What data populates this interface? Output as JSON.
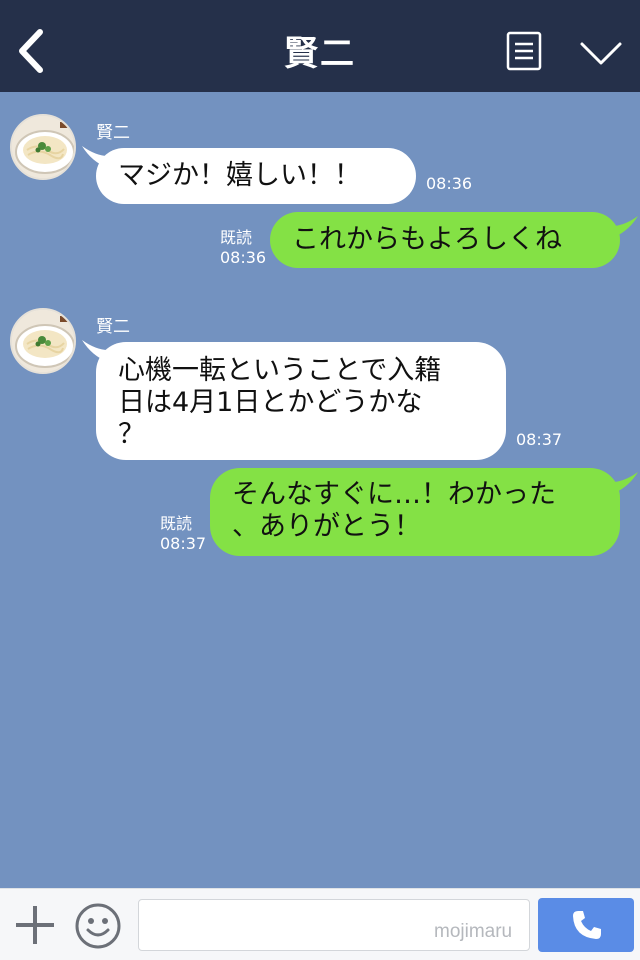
{
  "header": {
    "title": "賢二"
  },
  "icons": {
    "back": "chevron-left-icon",
    "menu": "document-menu-icon",
    "collapse": "chevron-down-icon",
    "add": "plus-icon",
    "emoji": "smiley-icon",
    "call": "phone-icon"
  },
  "colors": {
    "header_bg": "#25304a",
    "chat_bg": "#7392c0",
    "incoming_bubble": "#ffffff",
    "outgoing_bubble": "#84e145",
    "call_button": "#5a8ce6"
  },
  "messages": [
    {
      "direction": "in",
      "sender": "賢二",
      "lines": [
        "マジか！嬉しい！！"
      ],
      "time": "08:36"
    },
    {
      "direction": "out",
      "read_label": "既読",
      "lines": [
        "これからもよろしくね"
      ],
      "time": "08:36"
    },
    {
      "direction": "in",
      "sender": "賢二",
      "lines": [
        "心機一転ということで入籍",
        "日は4月1日とかどうかな",
        "？"
      ],
      "time": "08:37"
    },
    {
      "direction": "out",
      "read_label": "既読",
      "lines": [
        "そんなすぐに…！わかった",
        "、ありがとう！"
      ],
      "time": "08:37"
    }
  ],
  "input_bar": {
    "placeholder": "",
    "watermark": "mojimaru"
  }
}
